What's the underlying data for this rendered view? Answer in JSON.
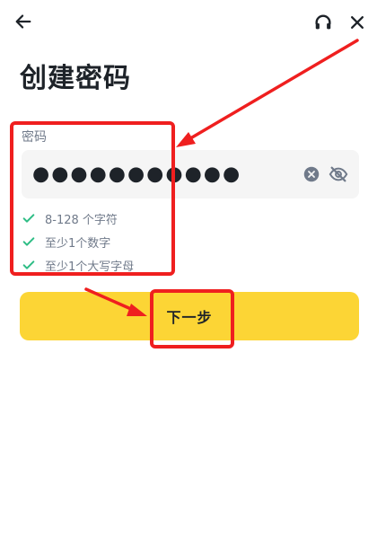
{
  "header": {
    "back_icon": "arrow-left-icon",
    "support_icon": "headset-icon",
    "close_icon": "close-icon"
  },
  "title": "创建密码",
  "password": {
    "label": "密码",
    "masked_value": "●●●●●●●●●●●",
    "clear_icon": "clear-circle-icon",
    "visibility_icon": "eye-off-icon"
  },
  "rules": [
    {
      "text": "8-128 个字符",
      "met": true
    },
    {
      "text": "至少1个数字",
      "met": true
    },
    {
      "text": "至少1个大写字母",
      "met": true
    }
  ],
  "next_button": {
    "label": "下一步"
  },
  "colors": {
    "accent": "#fcd535",
    "check": "#2ebd85",
    "annotation": "#ef1f1f",
    "text_primary": "#1e2329",
    "text_secondary": "#707a8a",
    "field_bg": "#f5f5f5"
  }
}
